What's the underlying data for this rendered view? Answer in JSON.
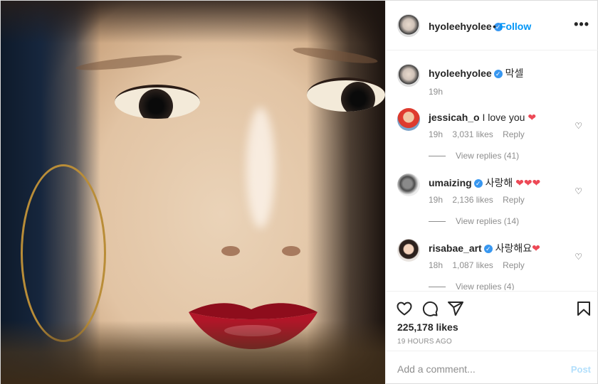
{
  "post": {
    "author": "hyoleehyolee",
    "follow_label": "Follow",
    "dot": "•",
    "more_label": "•••",
    "verified_mark": "✓"
  },
  "caption": {
    "username": "hyoleehyolee",
    "text": "막셀",
    "time": "19h"
  },
  "comments": [
    {
      "username": "jessicah_o",
      "verified": false,
      "text": "I love you",
      "hearts": "❤",
      "time": "19h",
      "likes": "3,031 likes",
      "reply": "Reply",
      "view_replies": "View replies (41)"
    },
    {
      "username": "umaizing",
      "verified": true,
      "text": "사랑해",
      "hearts": "❤❤❤",
      "time": "19h",
      "likes": "2,136 likes",
      "reply": "Reply",
      "view_replies": "View replies (14)"
    },
    {
      "username": "risabae_art",
      "verified": true,
      "text": "사랑해요",
      "hearts": "❤",
      "time": "18h",
      "likes": "1,087 likes",
      "reply": "Reply",
      "view_replies": "View replies (4)"
    }
  ],
  "comment_like_icon": "♡",
  "stats": {
    "likes": "225,178 likes",
    "time_ago": "19 HOURS AGO"
  },
  "add_comment": {
    "placeholder": "Add a comment...",
    "post_label": "Post"
  },
  "colors": {
    "accent": "#0095f6",
    "verified": "#3897f0",
    "heart": "#ed4956",
    "post_disabled": "#b2dffc"
  },
  "icons": [
    "heart-icon",
    "comment-icon",
    "share-icon",
    "bookmark-icon",
    "verified-icon",
    "more-icon"
  ]
}
